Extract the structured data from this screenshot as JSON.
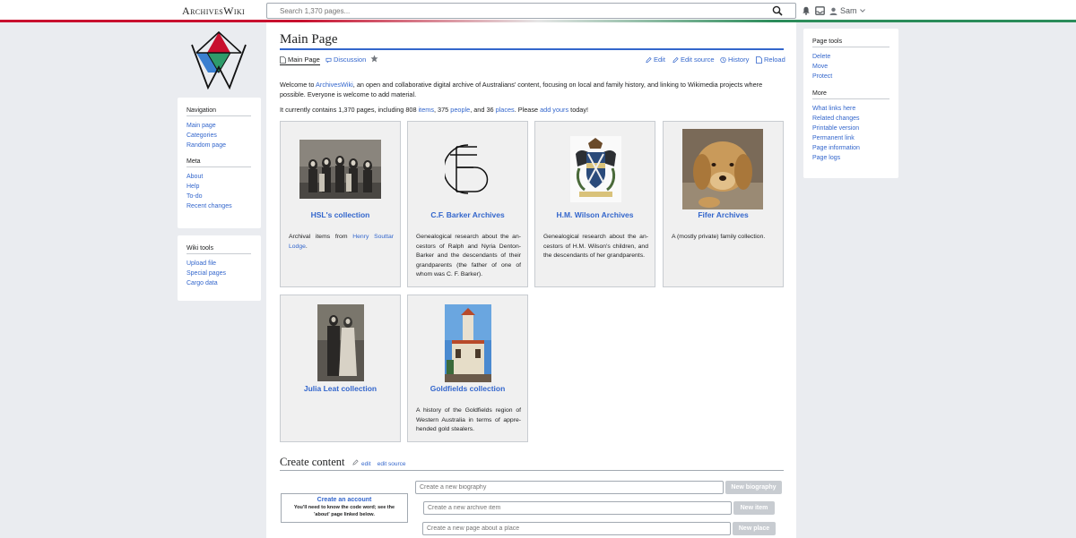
{
  "header": {
    "site_name": "ArchivesWiki",
    "search_placeholder": "Search 1,370 pages...",
    "username": "Sam"
  },
  "sidebar": {
    "navigation": {
      "heading": "Navigation",
      "items": [
        "Main page",
        "Categories",
        "Random page"
      ]
    },
    "meta": {
      "heading": "Meta",
      "items": [
        "About",
        "Help",
        "To-do",
        "Recent changes"
      ]
    },
    "wiki_tools": {
      "heading": "Wiki tools",
      "items": [
        "Upload file",
        "Special pages",
        "Cargo data"
      ]
    }
  },
  "page": {
    "title": "Main Page",
    "tabs": {
      "main": "Main Page",
      "discussion": "Discussion",
      "edit": "Edit",
      "edit_source": "Edit source",
      "history": "History",
      "reload": "Reload"
    },
    "intro": {
      "before": "Welcome to ",
      "link": "ArchivesWiki",
      "after": ", an open and collaborative digital archive of Australians' content, focusing on local and family history, and linking to Wikimedia projects where possible. Everyone is welcome to add material."
    },
    "stats": {
      "prefix": "It currently contains 1,370 pages, including 808 ",
      "items_link": "items",
      "mid1": ", 375 ",
      "people_link": "people",
      "mid2": ", and 36 ",
      "places_link": "places",
      "mid3": ". Please ",
      "add_link": "add yours",
      "suffix": " today!"
    },
    "collections": [
      {
        "title": "HSL's collection",
        "desc_before": "Archival items from ",
        "desc_link": "Henry Souttar Lodge",
        "desc_after": "."
      },
      {
        "title": "C.F. Barker Archives",
        "desc": "Genealogical research about the an­cestors of Ralph and Nyria Denton-Barker and the descendants of their grandparents (the father of one of whom was C. F. Barker)."
      },
      {
        "title": "H.M. Wilson Archives",
        "desc": "Genealogical research about the an­cestors of H.M. Wilson's children, and the descendants of her grand­parents."
      },
      {
        "title": "Fifer Archives",
        "desc": "A (mostly private) family collection."
      },
      {
        "title": "Julia Leat collection",
        "desc": ""
      },
      {
        "title": "Goldfields collection",
        "desc": "A history of the Goldfields region of Western Australia in terms of appre­hended gold stealers."
      }
    ],
    "create": {
      "heading": "Create content",
      "edit": "edit",
      "edit_source": "edit source",
      "account_title": "Create an account",
      "account_desc": "You'll need to know the code word; see the 'about' page linked below.",
      "biography_placeholder": "Create a new biography",
      "biography_button": "New biography",
      "item_placeholder": "Create a new archive item",
      "item_button": "New item",
      "place_placeholder": "Create a new page about a place",
      "place_button": "New place"
    }
  },
  "right_sidebar": {
    "page_tools": {
      "heading": "Page tools",
      "items": [
        "Delete",
        "Move",
        "Protect"
      ]
    },
    "more": {
      "heading": "More",
      "items": [
        "What links here",
        "Related changes",
        "Printable version",
        "Permanent link",
        "Page information",
        "Page logs"
      ]
    }
  }
}
